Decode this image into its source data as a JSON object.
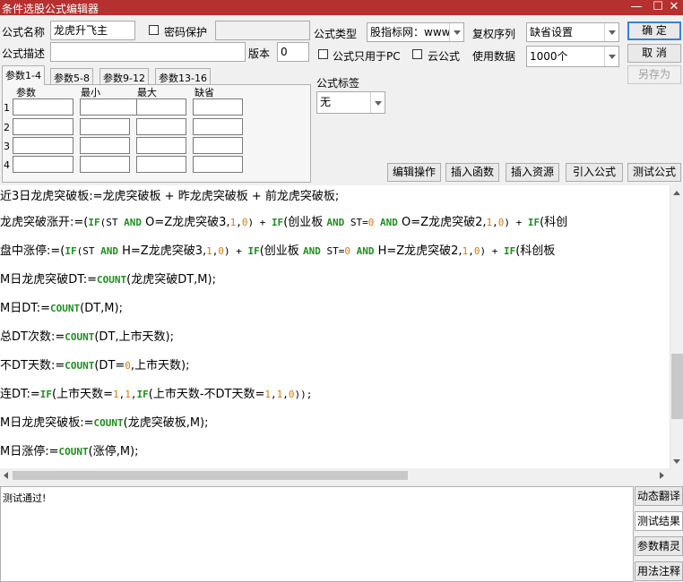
{
  "window": {
    "title": "条件选股公式编辑器",
    "min": "—",
    "restore": "☐",
    "close": "✕"
  },
  "form": {
    "name_label": "公式名称",
    "name_value": "龙虎升飞主",
    "password_label": "密码保护",
    "password_value": "",
    "desc_label": "公式描述",
    "desc_value": "",
    "version_label": "版本",
    "version_value": "0",
    "type_label": "公式类型",
    "type_value": "股指标网：www",
    "fq_label": "复权序列",
    "fq_value": "缺省设置",
    "pc_only_label": "公式只用于PC",
    "cloud_label": "云公式",
    "data_label": "使用数据",
    "data_value": "1000个",
    "tag_label": "公式标签",
    "tag_value": "无"
  },
  "buttons": {
    "ok": "确  定",
    "cancel": "取  消",
    "save_as": "另存为"
  },
  "params": {
    "tabs": [
      "参数1-4",
      "参数5-8",
      "参数9-12",
      "参数13-16"
    ],
    "headers": [
      "参数",
      "最小",
      "最大",
      "缺省"
    ],
    "rows": [
      "1",
      "2",
      "3",
      "4"
    ]
  },
  "toolbar": [
    "编辑操作",
    "插入函数",
    "插入资源",
    "引入公式",
    "测试公式"
  ],
  "code": {
    "l1": "近3日龙虎突破板:=龙虎突破板 + 昨龙虎突破板 + 前龙虎突破板;",
    "l2a": "龙虎突破涨开:=(",
    "l2b": "IF",
    "l2c": "(ST ",
    "l2d": "AND",
    "l2e": " O=Z龙虎突破3,",
    "l2f": "1",
    "l2g": ",",
    "l2h": "0",
    "l2i": ") + ",
    "l2j": "IF",
    "l2k": "(创业板 ",
    "l2l": "AND",
    "l2m": " ST=",
    "l2n": "0",
    "l2o": " ",
    "l2p": "AND",
    "l2q": " O=Z龙虎突破2,",
    "l2r": "1",
    "l2s": ",",
    "l2t": "0",
    "l2u": ") + ",
    "l2v": "IF",
    "l2w": "(科创",
    "l3a": "盘中涨停:=(",
    "l3b": "IF",
    "l3c": "(ST ",
    "l3d": "AND",
    "l3e": " H=Z龙虎突破3,",
    "l3f": "1",
    "l3g": ",",
    "l3h": "0",
    "l3i": ") + ",
    "l3j": "IF",
    "l3k": "(创业板 ",
    "l3l": "AND",
    "l3m": " ST=",
    "l3n": "0",
    "l3o": " ",
    "l3p": "AND",
    "l3q": " H=Z龙虎突破2,",
    "l3r": "1",
    "l3s": ",",
    "l3t": "0",
    "l3u": ") + ",
    "l3v": "IF",
    "l3w": "(科创板",
    "l4a": "M日龙虎突破DT:=",
    "l4b": "COUNT",
    "l4c": "(龙虎突破DT,M);",
    "l5a": "M日DT:=",
    "l5b": "COUNT",
    "l5c": "(DT,M);",
    "l6a": "总DT次数:=",
    "l6b": "COUNT",
    "l6c": "(DT,上市天数);",
    "l7a": "不DT天数:=",
    "l7b": "COUNT",
    "l7c": "(DT=",
    "l7d": "0",
    "l7e": ",上市天数);",
    "l8a": "连DT:=",
    "l8b": "IF",
    "l8c": "(上市天数=",
    "l8d": "1",
    "l8e": ",",
    "l8f": "1",
    "l8g": ",",
    "l8h": "IF",
    "l8i": "(上市天数-不DT天数=",
    "l8j": "1",
    "l8k": ",",
    "l8l": "1",
    "l8m": ",",
    "l8n": "0",
    "l8o": "));",
    "l9a": "M日龙虎突破板:=",
    "l9b": "COUNT",
    "l9c": "(龙虎突破板,M);",
    "l10a": "M日涨停:=",
    "l10b": "COUNT",
    "l10c": "(涨停,M);"
  },
  "output": {
    "text": "测试通过!"
  },
  "side_buttons": [
    "动态翻译",
    "测试结果",
    "参数精灵",
    "用法注释"
  ],
  "colors": {
    "title_bar": "#b5302f",
    "function": "#1d8f1d",
    "number": "#e07a00"
  }
}
